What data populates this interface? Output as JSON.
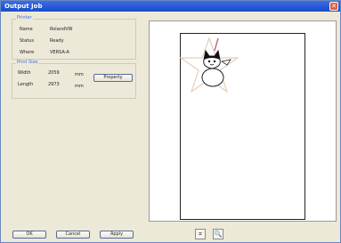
{
  "window": {
    "title": "Output Job"
  },
  "printer": {
    "group_title": "Printer",
    "rows": [
      {
        "label": "Name",
        "value": "RolandVW"
      },
      {
        "label": "Status",
        "value": "Ready"
      },
      {
        "label": "Where",
        "value": "VERSA-A"
      }
    ]
  },
  "print_size": {
    "group_title": "Print Size",
    "width_label": "Width",
    "width_value": "2059",
    "width_unit": "mm",
    "length_label": "Length",
    "length_value": "2973",
    "length_unit": "mm",
    "property_button": "Property"
  },
  "buttons": {
    "ok": "OK",
    "cancel": "Cancel",
    "apply": "Apply"
  },
  "icons": {
    "fit": "fit-page-icon",
    "zoom": "zoom-icon",
    "close": "close-icon"
  }
}
